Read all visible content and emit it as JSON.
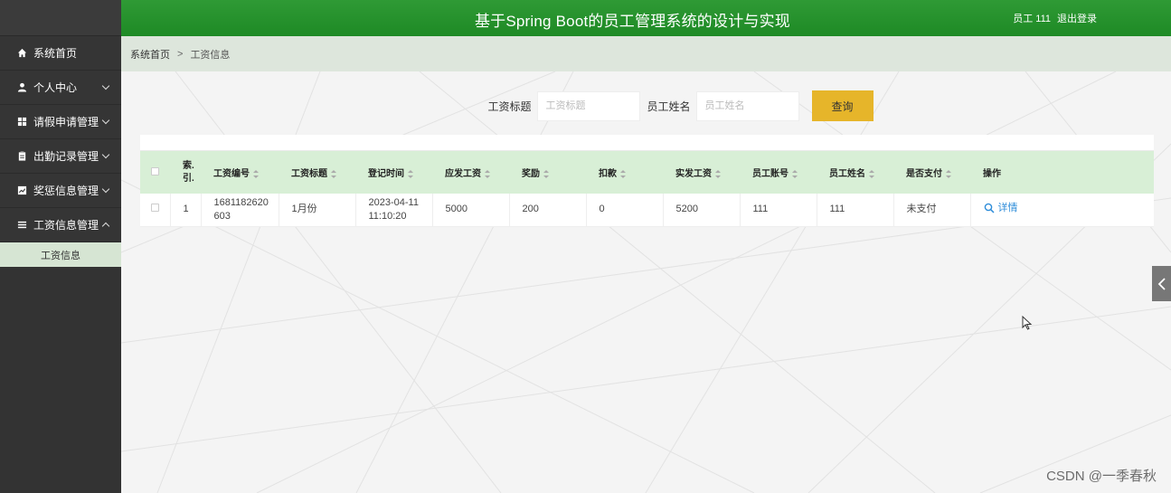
{
  "header": {
    "title": "基于Spring Boot的员工管理系统的设计与实现",
    "user": "员工 111",
    "logout": "退出登录"
  },
  "sidebar": {
    "items": [
      {
        "label": "系统首页",
        "icon": "home-icon",
        "expandable": false
      },
      {
        "label": "个人中心",
        "icon": "user-icon",
        "expandable": true
      },
      {
        "label": "请假申请管理",
        "icon": "grid-icon",
        "expandable": true
      },
      {
        "label": "出勤记录管理",
        "icon": "clipboard-icon",
        "expandable": true
      },
      {
        "label": "奖惩信息管理",
        "icon": "chart-icon",
        "expandable": true
      },
      {
        "label": "工资信息管理",
        "icon": "list-icon",
        "expandable": true,
        "expanded": true
      }
    ],
    "sub_item": "工资信息"
  },
  "breadcrumb": {
    "home": "系统首页",
    "separator": ">",
    "current": "工资信息"
  },
  "search": {
    "title_label": "工资标题",
    "title_placeholder": "工资标题",
    "name_label": "员工姓名",
    "name_placeholder": "员工姓名",
    "button": "查询"
  },
  "table": {
    "headers": [
      "索引",
      "工资编号",
      "工资标题",
      "登记时间",
      "应发工资",
      "奖励",
      "扣款",
      "实发工资",
      "员工账号",
      "员工姓名",
      "是否支付",
      "操作"
    ],
    "index_header_lines": [
      "索.",
      "引."
    ],
    "rows": [
      {
        "index": "1",
        "number_lines": [
          "1681182620",
          "603"
        ],
        "title": "1月份",
        "time_lines": [
          "2023-04-11",
          "11:10:20"
        ],
        "gross": "5000",
        "bonus": "200",
        "deduction": "0",
        "net": "5200",
        "account": "111",
        "name": "111",
        "paid": "未支付",
        "action": "详情"
      }
    ]
  },
  "watermark": "CSDN @一季春秋",
  "colors": {
    "header_green": "#23902a",
    "search_button": "#e6b52a",
    "table_header": "#d8efd6",
    "sidebar": "#333333",
    "link": "#2d8cd9"
  }
}
